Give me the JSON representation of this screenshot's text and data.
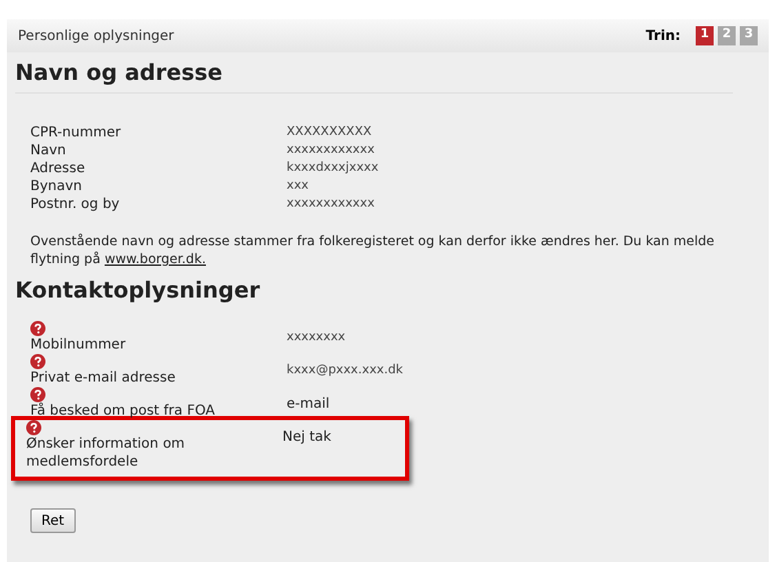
{
  "header": {
    "title": "Personlige oplysninger",
    "steps_label": "Trin:",
    "steps": [
      {
        "label": "1",
        "selected": true
      },
      {
        "label": "2",
        "selected": false
      },
      {
        "label": "3",
        "selected": false
      }
    ]
  },
  "address": {
    "heading": "Navn og adresse",
    "rows": [
      {
        "label": "CPR-nummer",
        "value": "XXXXXXXXXX"
      },
      {
        "label": "Navn",
        "value": "xxxxxxxxxxxx"
      },
      {
        "label": "Adresse",
        "value": "kxxxdxxxjxxxx"
      },
      {
        "label": "Bynavn",
        "value": "xxx"
      },
      {
        "label": "Postnr. og by",
        "value": "xxxxxxxxxxxx"
      }
    ],
    "note": "Ovenstående navn og adresse stammer fra folkeregisteret og kan derfor ikke ændres her. Du kan melde flytning på",
    "note_link": "www.borger.dk."
  },
  "contact": {
    "heading": "Kontaktoplysninger",
    "rows": [
      {
        "label": "Mobilnummer",
        "value": "xxxxxxxx",
        "highlighted": false
      },
      {
        "label": "Privat e-mail adresse",
        "value": "kxxx@pxxx.xxx.dk",
        "highlighted": false
      },
      {
        "label": "Få besked om post fra FOA",
        "value": "e-mail",
        "highlighted": false
      },
      {
        "label": "Ønsker information om medlemsfordele",
        "value": "Nej tak",
        "highlighted": true
      }
    ]
  },
  "edit_button": "Ret"
}
